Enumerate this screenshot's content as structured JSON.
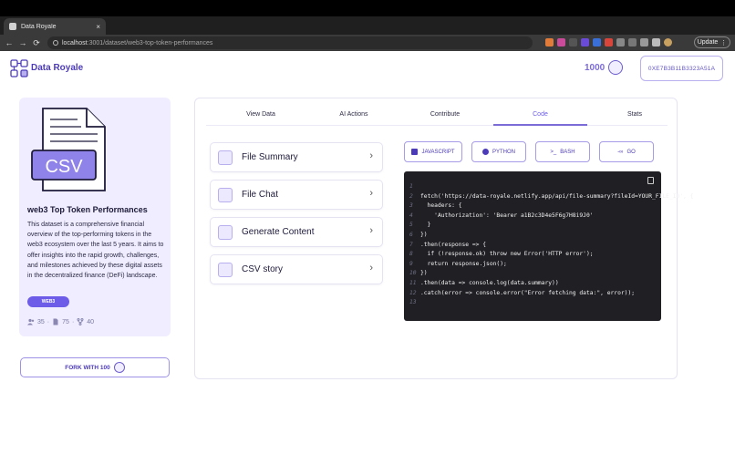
{
  "browser": {
    "tab_title": "Data Royale",
    "tab_close": "×",
    "new_tab": "+",
    "url_host": "localhost",
    "url_path": ":3001/dataset/web3-top-token-performances",
    "update_label": "Update",
    "nav": {
      "back": "←",
      "forward": "→",
      "reload": "⟳"
    }
  },
  "header": {
    "brand": "Data Royale",
    "token_count": "1000",
    "wallet_address": "0XE7B3B11B3323A51A"
  },
  "dataset": {
    "title": "web3 Top Token Performances",
    "description": "This dataset is a comprehensive financial overview of the top-performing tokens in the web3 ecosystem over the last 5 years. It aims to offer insights into the rapid growth, challenges, and milestones achieved by these digital assets in the decentralized finance (DeFi) landscape.",
    "tag": "WEB3",
    "stats": {
      "users": "35",
      "files": "75",
      "forks": "40",
      "sep": "·"
    },
    "illustration_text": "CSV"
  },
  "fork": {
    "label": "FORK WITH 100"
  },
  "tabs": [
    {
      "label": "View Data"
    },
    {
      "label": "AI Actions"
    },
    {
      "label": "Contribute"
    },
    {
      "label": "Code"
    },
    {
      "label": "Stats"
    }
  ],
  "actions": [
    {
      "label": "File Summary"
    },
    {
      "label": "File Chat"
    },
    {
      "label": "Generate Content"
    },
    {
      "label": "CSV story"
    }
  ],
  "chevron": "›",
  "languages": [
    {
      "label": "JAVASCRIPT"
    },
    {
      "label": "PYTHON"
    },
    {
      "label": "BASH"
    },
    {
      "label": "GO"
    }
  ],
  "code": [
    {
      "n": "1",
      "text": ""
    },
    {
      "n": "2",
      "text": "fetch('https://data-royale.netlify.app/api/file-summary?fileId=YOUR_FILE_ID', {"
    },
    {
      "n": "3",
      "text": "  headers: {"
    },
    {
      "n": "4",
      "text": "    'Authorization': 'Bearer a1B2c3D4e5F6g7H8i9J0'"
    },
    {
      "n": "5",
      "text": "  }"
    },
    {
      "n": "6",
      "text": "})"
    },
    {
      "n": "7",
      "text": ".then(response => {"
    },
    {
      "n": "8",
      "text": "  if (!response.ok) throw new Error('HTTP error');"
    },
    {
      "n": "9",
      "text": "  return response.json();"
    },
    {
      "n": "10",
      "text": "})"
    },
    {
      "n": "11",
      "text": ".then(data => console.log(data.summary))"
    },
    {
      "n": "12",
      "text": ".catch(error => console.error(\"Error fetching data:\", error));"
    },
    {
      "n": "13",
      "text": ""
    }
  ],
  "colors": {
    "accent": "#6c5ce7",
    "brand": "#4c3bb8",
    "card_bg": "#efedff",
    "code_bg": "#1f1f24"
  }
}
